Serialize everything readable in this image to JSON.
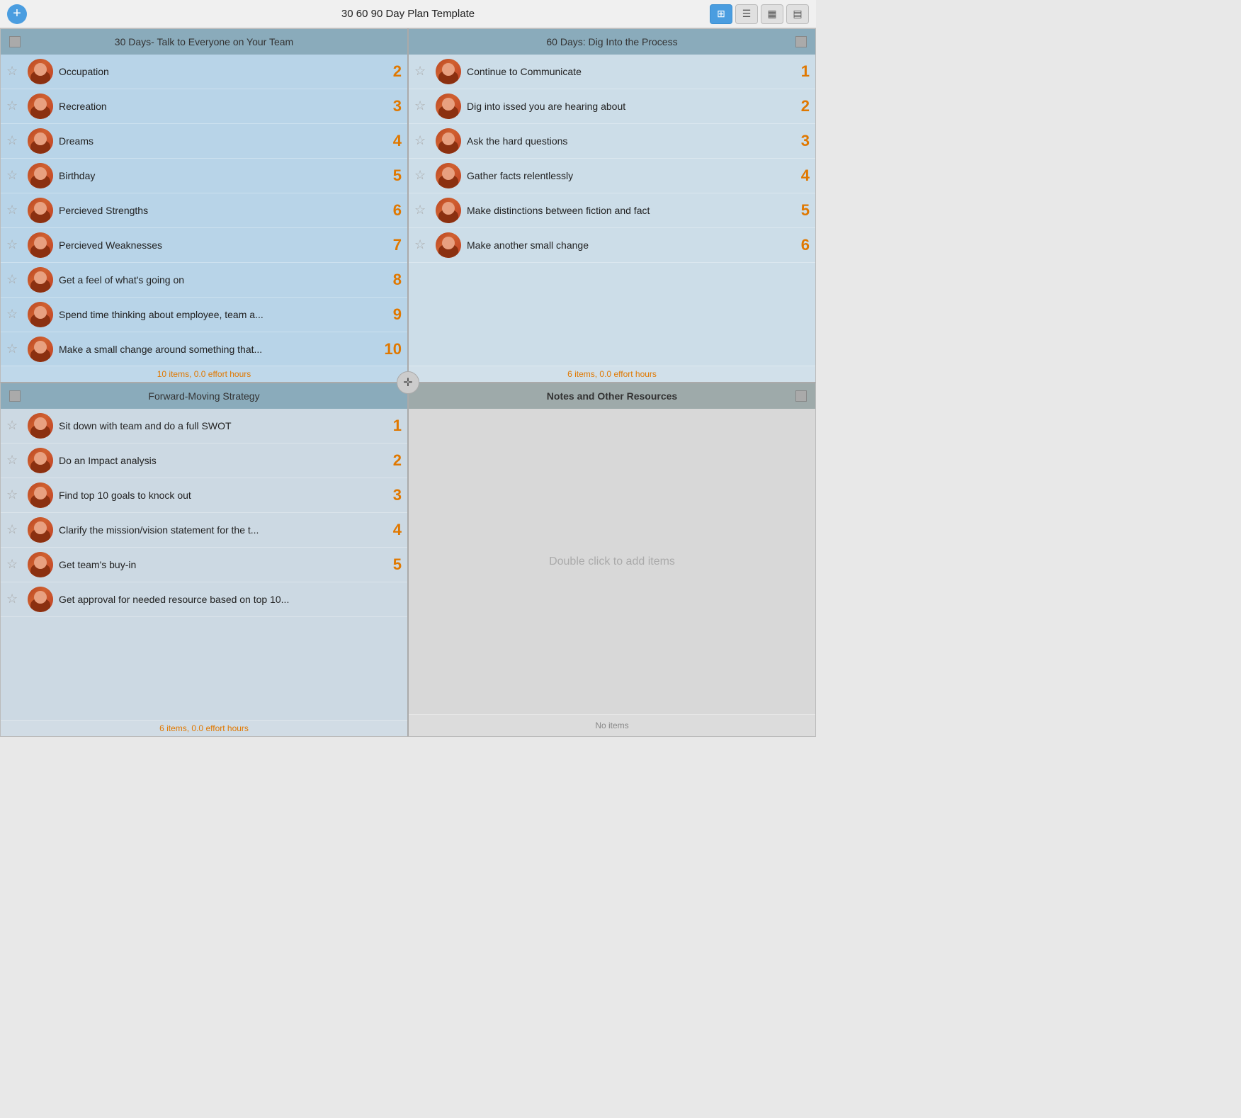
{
  "titleBar": {
    "title": "30 60 90 Day Plan Template",
    "addIcon": "+",
    "controls": [
      {
        "id": "grid-view",
        "icon": "⊞",
        "active": true
      },
      {
        "id": "list-view",
        "icon": "☰",
        "active": false
      },
      {
        "id": "calendar-view",
        "icon": "📅",
        "active": false
      },
      {
        "id": "chart-view",
        "icon": "📊",
        "active": false
      }
    ]
  },
  "quadrants": {
    "q1": {
      "header": "30 Days- Talk to Everyone on Your Team",
      "items": [
        {
          "text": "Occupation",
          "number": "2"
        },
        {
          "text": "Recreation",
          "number": "3"
        },
        {
          "text": "Dreams",
          "number": "4"
        },
        {
          "text": "Birthday",
          "number": "5"
        },
        {
          "text": "Percieved Strengths",
          "number": "6"
        },
        {
          "text": "Percieved Weaknesses",
          "number": "7"
        },
        {
          "text": "Get a feel of what's going on",
          "number": "8"
        },
        {
          "text": "Spend time thinking about employee, team a...",
          "number": "9"
        },
        {
          "text": "Make a small change around something that...",
          "number": "10"
        }
      ],
      "footer": "10 items, 0.0 effort hours"
    },
    "q2": {
      "header": "60 Days: Dig Into the Process",
      "items": [
        {
          "text": "Continue to Communicate",
          "number": "1"
        },
        {
          "text": "Dig into issed you are hearing about",
          "number": "2"
        },
        {
          "text": "Ask the hard questions",
          "number": "3"
        },
        {
          "text": "Gather facts relentlessly",
          "number": "4"
        },
        {
          "text": "Make distinctions between fiction and fact",
          "number": "5"
        },
        {
          "text": "Make another small change",
          "number": "6"
        }
      ],
      "footer": "6 items, 0.0 effort hours"
    },
    "q3": {
      "header": "Forward-Moving Strategy",
      "items": [
        {
          "text": "Sit down with team and do a full SWOT",
          "number": "1"
        },
        {
          "text": "Do an Impact analysis",
          "number": "2"
        },
        {
          "text": "Find top 10 goals to knock out",
          "number": "3"
        },
        {
          "text": "Clarify the mission/vision statement for the t...",
          "number": "4"
        },
        {
          "text": "Get team's buy-in",
          "number": "5"
        },
        {
          "text": "Get approval for needed resource based on top 10...",
          "number": ""
        }
      ],
      "footer": "6 items, 0.0 effort hours"
    },
    "q4": {
      "header": "Notes and Other Resources",
      "items": [],
      "addHint": "Double click to add items",
      "footer": "No items"
    }
  }
}
